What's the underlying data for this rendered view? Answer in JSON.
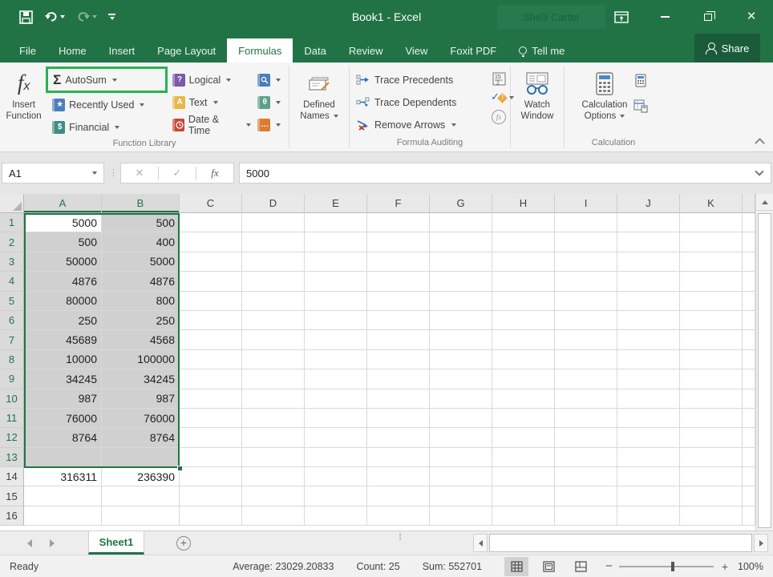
{
  "titlebar": {
    "title": "Book1  -  Excel",
    "user_name": "Shelli Carter"
  },
  "tabs": {
    "items": [
      "File",
      "Home",
      "Insert",
      "Page Layout",
      "Formulas",
      "Data",
      "Review",
      "View",
      "Foxit PDF",
      "Tell me"
    ],
    "active": "Formulas",
    "share": "Share"
  },
  "ribbon": {
    "function_library": {
      "group_label": "Function Library",
      "insert_function_line1": "Insert",
      "insert_function_line2": "Function",
      "autosum": "AutoSum",
      "recently_used": "Recently Used",
      "financial": "Financial",
      "logical": "Logical",
      "text": "Text",
      "date_time": "Date & Time"
    },
    "defined_names": {
      "line1": "Defined",
      "line2": "Names"
    },
    "formula_auditing": {
      "group_label": "Formula Auditing",
      "trace_precedents": "Trace Precedents",
      "trace_dependents": "Trace Dependents",
      "remove_arrows": "Remove Arrows"
    },
    "watch_window": {
      "line1": "Watch",
      "line2": "Window"
    },
    "calculation": {
      "group_label": "Calculation",
      "options_line1": "Calculation",
      "options_line2": "Options"
    }
  },
  "formula_bar": {
    "name_box": "A1",
    "fx_label": "fx",
    "value": "5000"
  },
  "grid": {
    "columns": [
      "A",
      "B",
      "C",
      "D",
      "E",
      "F",
      "G",
      "H",
      "I",
      "J",
      "K"
    ],
    "selected_columns": [
      "A",
      "B"
    ],
    "selected_row_count": 13,
    "active_cell": "A1",
    "rows": [
      {
        "n": 1,
        "a": "5000",
        "b": "500"
      },
      {
        "n": 2,
        "a": "500",
        "b": "400"
      },
      {
        "n": 3,
        "a": "50000",
        "b": "5000"
      },
      {
        "n": 4,
        "a": "4876",
        "b": "4876"
      },
      {
        "n": 5,
        "a": "80000",
        "b": "800"
      },
      {
        "n": 6,
        "a": "250",
        "b": "250"
      },
      {
        "n": 7,
        "a": "45689",
        "b": "4568"
      },
      {
        "n": 8,
        "a": "10000",
        "b": "100000"
      },
      {
        "n": 9,
        "a": "34245",
        "b": "34245"
      },
      {
        "n": 10,
        "a": "987",
        "b": "987"
      },
      {
        "n": 11,
        "a": "76000",
        "b": "76000"
      },
      {
        "n": 12,
        "a": "8764",
        "b": "8764"
      },
      {
        "n": 13,
        "a": "",
        "b": ""
      },
      {
        "n": 14,
        "a": "316311",
        "b": "236390"
      },
      {
        "n": 15,
        "a": "",
        "b": ""
      },
      {
        "n": 16,
        "a": "",
        "b": ""
      }
    ]
  },
  "sheet_bar": {
    "active_sheet": "Sheet1"
  },
  "status_bar": {
    "mode": "Ready",
    "average_label": "Average: 23029.20833",
    "count_label": "Count: 25",
    "sum_label": "Sum: 552701",
    "zoom_level": "100%"
  },
  "colors": {
    "brand_green": "#217346",
    "highlight_green": "#28b351",
    "share_green": "#1a5c39",
    "selection_fill": "#d0d0d0"
  }
}
